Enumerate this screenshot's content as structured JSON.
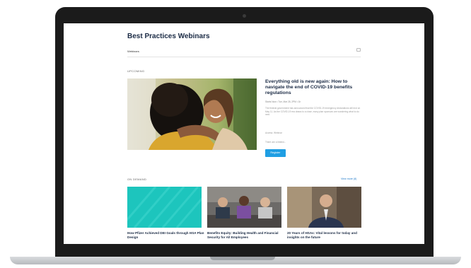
{
  "page": {
    "title": "Best Practices Webinars",
    "nav_link": "Webinars"
  },
  "upcoming": {
    "label": "UPCOMING",
    "title": "Everything old is new again: How to navigate the end of COVID-19 benefits regulations",
    "meta": "Starts Now • Tue, Mar 28, 2PM • 1h",
    "description": "The federal government has announced that the COVID-19 emergency declarations will end on May 11. As the COVID-19 era draws to a close, many plan sponsors are wondering what to do next.",
    "access_label": "Access: Webinar",
    "more_label": "There are a limited...",
    "register_label": "Register"
  },
  "on_demand": {
    "label": "ON DEMAND",
    "view_more": "View more (8)",
    "cards": [
      {
        "title": "How Pfizer Achieved DEI Goals through HSA Plan Design"
      },
      {
        "title": "Benefits Equity: Building Health and Financial Security for All Employees"
      },
      {
        "title": "20 Years of HSAs: Vital lessons for today and insights on the future"
      }
    ]
  },
  "colors": {
    "brand_navy": "#1a2a44",
    "accent_blue": "#1f9ee3",
    "teal_card": "#1dc5bd"
  }
}
